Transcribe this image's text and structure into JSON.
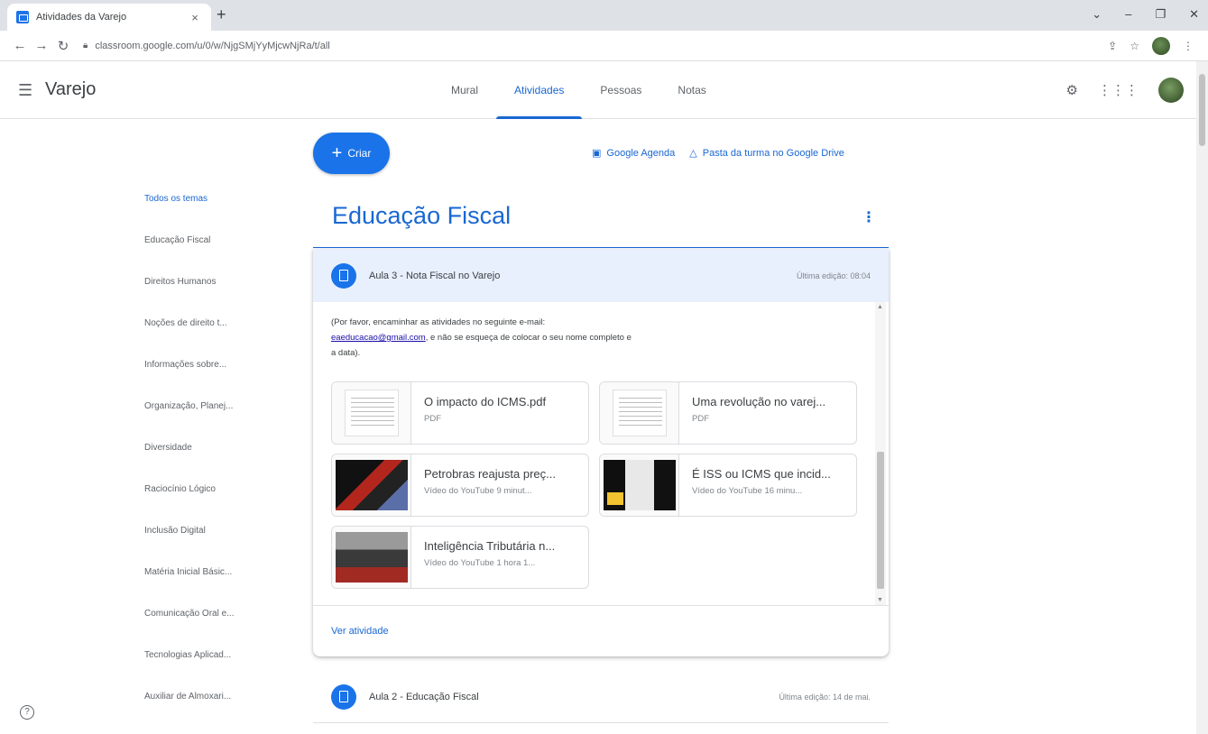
{
  "browser": {
    "tab_title": "Atividades da Varejo",
    "tab_close": "×",
    "new_tab": "+",
    "url": "classroom.google.com/u/0/w/NjgSMjYyMjcwNjRa/t/all",
    "window_controls": [
      "⌄",
      "–",
      "❐",
      "✕"
    ]
  },
  "header": {
    "class_name": "Varejo",
    "tabs": [
      "Mural",
      "Atividades",
      "Pessoas",
      "Notas"
    ],
    "active_tab": "Atividades"
  },
  "actions": {
    "create_label": "Criar",
    "calendar_link": "Google Agenda",
    "drive_link": "Pasta da turma no Google Drive"
  },
  "topics": [
    "Todos os temas",
    "Educação Fiscal",
    "Direitos Humanos",
    "Noções de direito t...",
    "Informações sobre...",
    "Organização, Planej...",
    "Diversidade",
    "Raciocínio Lógico",
    "Inclusão Digital",
    "Matéria Inicial Básic...",
    "Comunicação Oral e...",
    "Tecnologias Aplicad...",
    "Auxiliar de Almoxari..."
  ],
  "section": {
    "title": "Educação Fiscal",
    "more_icon": "⋮"
  },
  "assignment": {
    "title": "Aula 3 - Nota Fiscal no Varejo",
    "edited": "Última edição: 08:04",
    "description_before": "(Por favor, encaminhar as atividades no seguinte e-mail:",
    "email": "eaeducacao@gmail.com",
    "description_after": ", e não se esqueça de colocar o seu nome completo e a data).",
    "attachments": [
      {
        "title": "O impacto do ICMS.pdf",
        "sub": "PDF",
        "kind": "pdf"
      },
      {
        "title": "Uma revolução no varej...",
        "sub": "PDF",
        "kind": "pdf"
      },
      {
        "title": "Petrobras reajusta preç...",
        "sub": "Vídeo do YouTube  9 minut...",
        "kind": "video"
      },
      {
        "title": "É ISS ou ICMS que incid...",
        "sub": "Vídeo do YouTube  16 minu...",
        "kind": "video"
      },
      {
        "title": "Inteligência Tributária n...",
        "sub": "Vídeo do YouTube  1 hora 1...",
        "kind": "video"
      }
    ],
    "view_link": "Ver atividade"
  },
  "next_assignment": {
    "title": "Aula 2 - Educação Fiscal",
    "edited": "Última edição: 14 de mai."
  },
  "colors": {
    "accent": "#1967d2",
    "create_button": "#1a73e8",
    "header_band": "#e8f0fe"
  }
}
